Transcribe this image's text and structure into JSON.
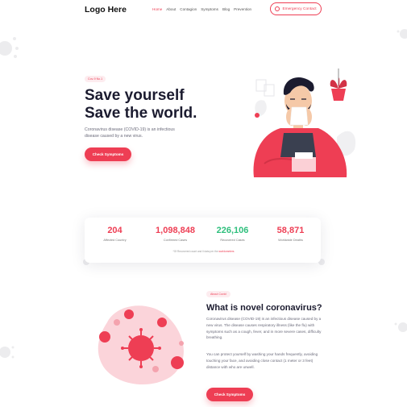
{
  "header": {
    "logo": "Logo Here",
    "nav": [
      "Home",
      "About",
      "Contagion",
      "Symptoms",
      "Blog",
      "Prevention"
    ],
    "emergency_button": "Emergency Contact"
  },
  "hero": {
    "badge": "Cov-9 No.1",
    "title_line1": "Save yourself",
    "title_line2": "Save the world.",
    "description": "Coronavirus disease (COVID-19) is an infectious disease caused by a new virus.",
    "button": "Check Symptoms"
  },
  "stats": {
    "items": [
      {
        "value": "204",
        "label": "Affected Country",
        "color": "#ee3e54"
      },
      {
        "value": "1,098,848",
        "label": "Confirmed Cases",
        "color": "#ee3e54"
      },
      {
        "value": "226,106",
        "label": "Recovered Cases",
        "color": "#2ebf7c"
      },
      {
        "value": "58,871",
        "label": "Worldwide Deaths",
        "color": "#ee3e54"
      }
    ],
    "note": "*Of Recovered count and ll data per the",
    "note_link": "worldometers"
  },
  "about": {
    "badge": "About Covid",
    "title": "What is novel coronavirus?",
    "paragraph1": "Coronavirus disease (COVID-19) is an infectious disease caused by a new virus. The disease causes respiratory illness (like the flu) with symptoms such as a cough, fever, and in more severe cases, difficulty breathing.",
    "paragraph2": "You can protect yourself by washing your hands frequently, avoiding touching your face, and avoiding close contact (1 meter or 3 feet) distance with who are unwell.",
    "button": "Check Symptoms"
  },
  "colors": {
    "accent": "#ee3e54",
    "green": "#2ebf7c"
  }
}
